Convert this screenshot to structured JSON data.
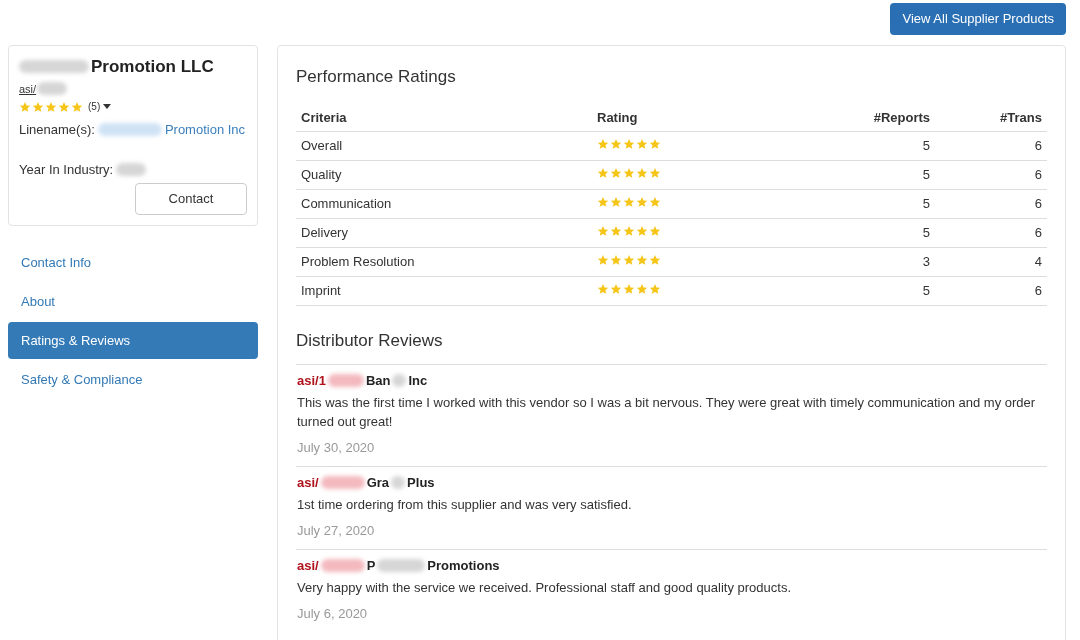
{
  "top_button": "View All Supplier Products",
  "supplier": {
    "name_visible": "Promotion LLC",
    "asi_visible": "asi/",
    "stars": 5,
    "review_count": "(5)",
    "linename_label": "Linename(s):",
    "linename_visible": "Promotion Inc",
    "year_label": "Year In Industry:",
    "contact_button": "Contact"
  },
  "nav": [
    {
      "label": "Contact Info",
      "selected": false
    },
    {
      "label": "About",
      "selected": false
    },
    {
      "label": "Ratings & Reviews",
      "selected": true
    },
    {
      "label": "Safety & Compliance",
      "selected": false
    }
  ],
  "ratings": {
    "title": "Performance Ratings",
    "columns": [
      "Criteria",
      "Rating",
      "#Reports",
      "#Trans"
    ],
    "rows": [
      {
        "criteria": "Overall",
        "stars": 5,
        "reports": "5",
        "trans": "6"
      },
      {
        "criteria": "Quality",
        "stars": 5,
        "reports": "5",
        "trans": "6"
      },
      {
        "criteria": "Communication",
        "stars": 5,
        "reports": "5",
        "trans": "6"
      },
      {
        "criteria": "Delivery",
        "stars": 5,
        "reports": "5",
        "trans": "6"
      },
      {
        "criteria": "Problem Resolution",
        "stars": 5,
        "reports": "3",
        "trans": "4"
      },
      {
        "criteria": "Imprint",
        "stars": 5,
        "reports": "5",
        "trans": "6"
      }
    ]
  },
  "reviews": {
    "title": "Distributor Reviews",
    "items": [
      {
        "id_visible": "asi/1",
        "name_parts": [
          "Ban",
          "Inc"
        ],
        "text": "This was the first time I worked with this vendor so I was a bit nervous. They were great with timely communication and my order turned out great!",
        "date": "July 30, 2020"
      },
      {
        "id_visible": "asi/",
        "name_parts": [
          "Gra",
          "Plus"
        ],
        "text": "1st time ordering from this supplier and was very satisfied.",
        "date": "July 27, 2020"
      },
      {
        "id_visible": "asi/",
        "name_parts": [
          "P",
          "Promotions"
        ],
        "text": "Very happy with the service we received. Professional staff and good quality products.",
        "date": "July 6, 2020"
      }
    ]
  }
}
